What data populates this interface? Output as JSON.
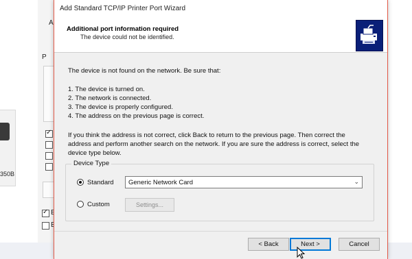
{
  "background": {
    "printer_label": "350B",
    "side_letters": [
      "A",
      "P",
      "E",
      "E"
    ],
    "checkboxes": [
      {
        "checked": true
      },
      {
        "checked": false
      },
      {
        "checked": false
      },
      {
        "checked": false
      },
      {
        "checked": false
      }
    ],
    "bottom_checkboxes": [
      {
        "checked": true
      },
      {
        "checked": false
      }
    ]
  },
  "dialog": {
    "window_title": "Add Standard TCP/IP Printer Port Wizard",
    "header_title": "Additional port information required",
    "header_subtitle": "The device could not be identified.",
    "header_icon": "printer-network-icon",
    "intro": "The device is not found on the network.  Be sure that:",
    "checklist": [
      "1.  The device is turned on.",
      "2.  The network is connected.",
      "3.  The device is properly configured.",
      "4.  The address on the previous page is correct."
    ],
    "help_lines": [
      "If you think the address is not correct, click Back to return to the previous page.  Then correct the",
      "address and perform another search on the network.  If you are sure the address is correct, select the",
      "device type below."
    ],
    "device_type": {
      "group_label": "Device Type",
      "standard_label": "Standard",
      "standard_selected": true,
      "standard_value": "Generic Network Card",
      "custom_label": "Custom",
      "custom_selected": false,
      "settings_label": "Settings..."
    },
    "buttons": {
      "back": "< Back",
      "next": "Next >",
      "cancel": "Cancel"
    },
    "colors": {
      "accent_border": "#e45b4a",
      "icon_bg": "#0a1f78",
      "focus_blue": "#0078d7"
    }
  }
}
